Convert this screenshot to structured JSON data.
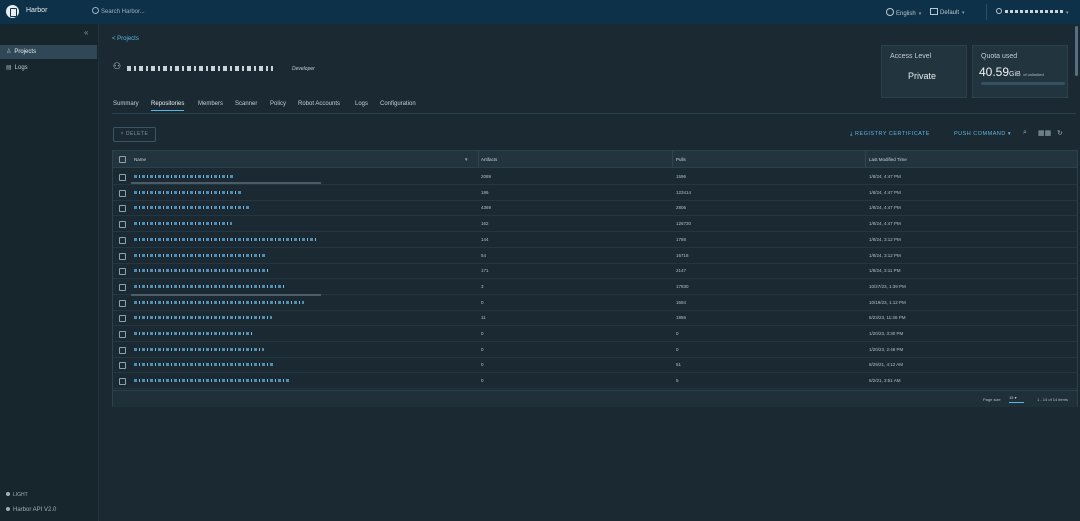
{
  "header": {
    "brand": "Harbor",
    "search_placeholder": "Search Harbor...",
    "language": "English",
    "scope": "Default"
  },
  "sidebar": {
    "items": [
      {
        "label": "Projects",
        "active": true,
        "icon": "projects-icon"
      },
      {
        "label": "Logs",
        "active": false,
        "icon": "logs-icon"
      }
    ],
    "theme_toggle": "LIGHT",
    "api_link": "Harbor API V2.0"
  },
  "breadcrumb": "< Projects",
  "project": {
    "role": "Developer"
  },
  "cards": {
    "access_level_title": "Access Level",
    "access_level_value": "Private",
    "quota_title": "Quota used",
    "quota_value": "40.59",
    "quota_unit": "GiB",
    "quota_suffix": "of unlimited"
  },
  "tabs": [
    "Summary",
    "Repositories",
    "Members",
    "Scanner",
    "Policy",
    "Robot Accounts",
    "Logs",
    "Configuration"
  ],
  "toolbar": {
    "delete_label": "× DELETE",
    "registry_cert_label": "REGISTRY CERTIFICATE",
    "push_command_label": "PUSH COMMAND"
  },
  "table": {
    "columns": [
      "Name",
      "Artifacts",
      "Pulls",
      "Last Modified Time"
    ],
    "rows": [
      {
        "artifacts": "2089",
        "pulls": "1596",
        "time": "1/8/24, 4:47 PM"
      },
      {
        "artifacts": "186",
        "pulls": "123414",
        "time": "1/8/24, 4:47 PM"
      },
      {
        "artifacts": "4369",
        "pulls": "2806",
        "time": "1/8/24, 4:47 PM"
      },
      {
        "artifacts": "162",
        "pulls": "126730",
        "time": "1/8/24, 4:47 PM"
      },
      {
        "artifacts": "144",
        "pulls": "1788",
        "time": "1/8/24, 3:12 PM"
      },
      {
        "artifacts": "54",
        "pulls": "16718",
        "time": "1/8/24, 3:12 PM"
      },
      {
        "artifacts": "171",
        "pulls": "2147",
        "time": "1/8/24, 3:11 PM"
      },
      {
        "artifacts": "3",
        "pulls": "17930",
        "time": "10/27/23, 1:39 PM"
      },
      {
        "artifacts": "0",
        "pulls": "1694",
        "time": "10/19/23, 1:12 PM"
      },
      {
        "artifacts": "11",
        "pulls": "1956",
        "time": "6/23/23, 11:36 PM"
      },
      {
        "artifacts": "0",
        "pulls": "0",
        "time": "1/20/23, 3:30 PM"
      },
      {
        "artifacts": "0",
        "pulls": "0",
        "time": "1/20/23, 2:48 PM"
      },
      {
        "artifacts": "0",
        "pulls": "51",
        "time": "8/29/21, 4:12 AM"
      },
      {
        "artifacts": "0",
        "pulls": "5",
        "time": "6/2/21, 3:51 AM"
      }
    ],
    "page_size_label": "Page size",
    "page_size_value": "15",
    "pagination": "1 - 14 of 14 items"
  },
  "colors": {
    "accent": "#5ab4e5",
    "header_bg": "#0c3148",
    "bg": "#1b2a32"
  }
}
